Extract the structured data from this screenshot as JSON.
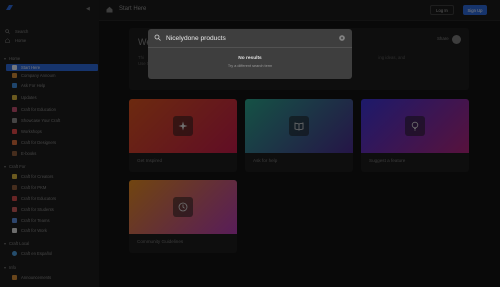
{
  "sidebar": {
    "top_items": [
      {
        "icon": "search-icon",
        "label": "Search"
      },
      {
        "icon": "home-icon",
        "label": "Home"
      }
    ],
    "sections": [
      {
        "title": "Home",
        "items": [
          {
            "icon": "flag-icon",
            "label": "Start Here",
            "active": true,
            "color": "#2d68d8"
          },
          {
            "icon": "megaphone-icon",
            "label": "Company Annoum",
            "color": "#d08b36"
          },
          {
            "icon": "chat-icon",
            "label": "Ask For Help",
            "color": "#3e8ad8"
          },
          {
            "icon": "lightbulb-icon",
            "label": "Updates",
            "color": "#d4b23e"
          },
          {
            "icon": "sparkle-icon",
            "label": "Craft for Education",
            "color": "#c04f6e"
          },
          {
            "icon": "pencil-icon",
            "label": "Showcase Your Craft",
            "color": "#888888"
          },
          {
            "icon": "calendar-icon",
            "label": "Workshops",
            "color": "#e04848"
          },
          {
            "icon": "cap-icon",
            "label": "Craft for Designers",
            "color": "#d26a3a"
          },
          {
            "icon": "book-icon",
            "label": "E-books",
            "color": "#8a5a3a"
          }
        ]
      },
      {
        "title": "Craft For",
        "items": [
          {
            "icon": "people-icon",
            "label": "Craft for Creators",
            "color": "#d4b23e"
          },
          {
            "icon": "briefcase-icon",
            "label": "Craft for PKM",
            "color": "#8a5a3a"
          },
          {
            "icon": "apple-icon",
            "label": "Craft for Educators",
            "color": "#d04a4a"
          },
          {
            "icon": "rocket-icon",
            "label": "Craft for Students",
            "color": "#c95a5a"
          },
          {
            "icon": "diamond-icon",
            "label": "Craft for Teams",
            "color": "#5a8ad8"
          },
          {
            "icon": "paper-icon",
            "label": "Craft for Work",
            "color": "#d8d8d8"
          }
        ]
      },
      {
        "title": "Craft Local",
        "items": [
          {
            "icon": "globe-icon",
            "label": "Craft en Español",
            "color": "#4a9ad8"
          }
        ]
      },
      {
        "title": "Info",
        "items": [
          {
            "icon": "megaphone-icon",
            "label": "Announcements",
            "color": "#d08b36"
          }
        ]
      }
    ]
  },
  "header": {
    "title": "Start Here",
    "login_label": "Log In",
    "signup_label": "Sign Up"
  },
  "banner": {
    "title": "We",
    "text": "Thi                                                              resources to help make the most out of it. We                                                              ing ideas, and",
    "subtext": "Use the cards below to get started.",
    "share_label": "Share"
  },
  "cards": [
    {
      "label": "Get Inspired",
      "icon": "sparkle-icon",
      "gradient_from": "#d9541f",
      "gradient_to": "#c21a4a"
    },
    {
      "label": "Ask for help",
      "icon": "book-open-icon",
      "gradient_from": "#2aa48a",
      "gradient_to": "#4a2b8f"
    },
    {
      "label": "Suggest a feature",
      "icon": "lightbulb-icon",
      "gradient_from": "#3a34d6",
      "gradient_to": "#b0247a"
    },
    {
      "label": "Community Guidelines",
      "icon": "compass-icon",
      "gradient_from": "#e28a1f",
      "gradient_to": "#b23ab2"
    }
  ],
  "search": {
    "value": "Nicelydone products",
    "no_results_title": "No results",
    "no_results_hint": "Try a different search term"
  },
  "colors": {
    "accent": "#2d68d8",
    "background": "#131313",
    "modal": "#3e3e3e"
  }
}
